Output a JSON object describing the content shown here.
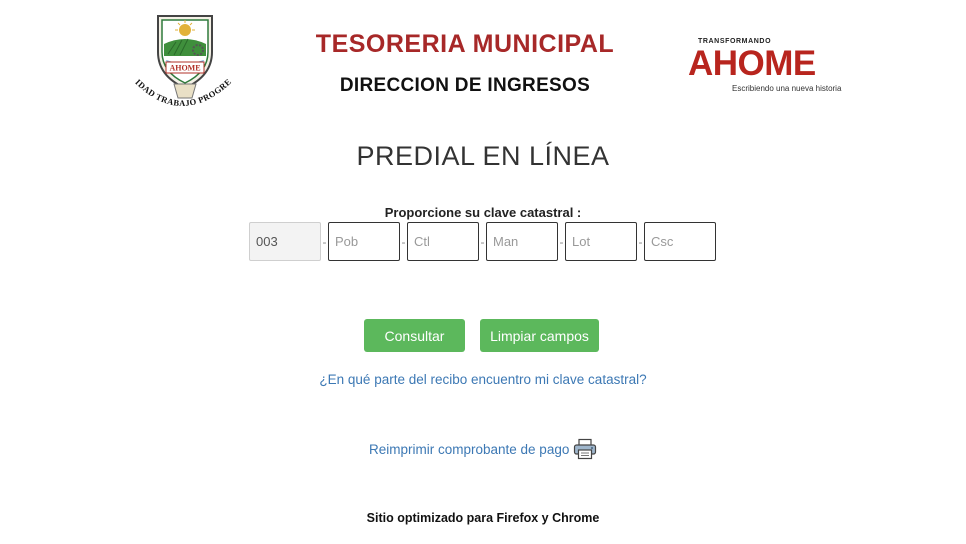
{
  "header": {
    "left_logo": {
      "shield_label": "AHOME",
      "arc_text": "UNIDAD TRABAJO PROGRESO"
    },
    "title": "TESORERIA MUNICIPAL",
    "subtitle": "DIRECCION DE INGRESOS",
    "right_logo": {
      "tagline_top": "TRANSFORMANDO",
      "wordmark": "AHOME",
      "tagline_bottom": "Escribiendo una nueva historia"
    }
  },
  "main": {
    "heading": "PREDIAL EN LÍNEA",
    "prompt": "Proporcione su clave catastral :",
    "clave_fields": [
      {
        "value": "003",
        "placeholder": "",
        "readonly": true
      },
      {
        "value": "",
        "placeholder": "Pob"
      },
      {
        "value": "",
        "placeholder": "Ctl"
      },
      {
        "value": "",
        "placeholder": "Man"
      },
      {
        "value": "",
        "placeholder": "Lot"
      },
      {
        "value": "",
        "placeholder": "Csc"
      }
    ],
    "separator": "-",
    "buttons": {
      "consultar": "Consultar",
      "limpiar": "Limpiar campos"
    },
    "help_link": "¿En qué parte del recibo encuentro mi clave catastral?",
    "reprint_link": "Reimprimir comprobante de pago",
    "reprint_icon": "printer-icon"
  },
  "footer": {
    "note": "Sitio optimizado para Firefox y Chrome"
  },
  "colors": {
    "title_red": "#a72828",
    "button_green": "#5cb85c",
    "link_blue": "#3c78b4"
  }
}
